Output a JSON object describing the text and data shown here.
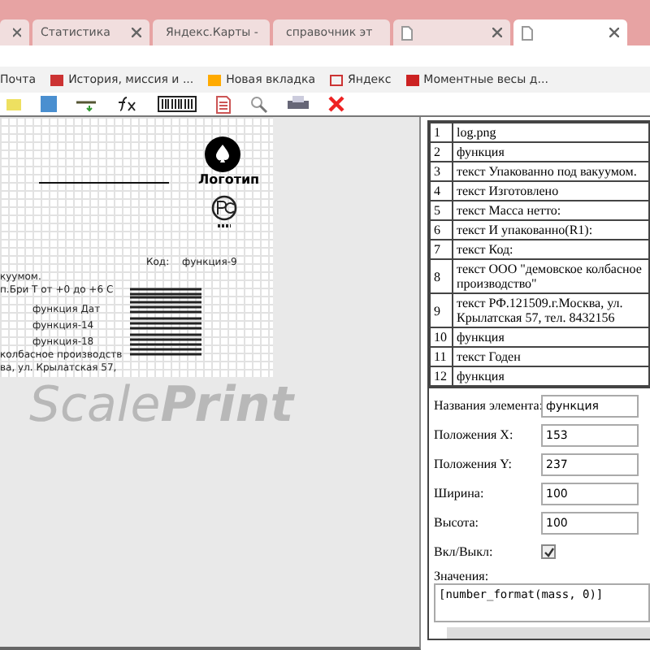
{
  "tabs": [
    {
      "selected": false
    },
    {
      "title": "Статистика",
      "selected": false,
      "kind": "plain"
    },
    {
      "title": "Яндекс.Карты -",
      "selected": false,
      "kind": "map"
    },
    {
      "title": "справочник эт",
      "selected": false,
      "kind": "doc"
    },
    {
      "selected": false,
      "kind": "doc"
    },
    {
      "selected": true,
      "kind": "doc"
    }
  ],
  "bookmarks": [
    {
      "title": "Почта",
      "kind": "plain"
    },
    {
      "title": "История, миссия и ...",
      "kind": "news"
    },
    {
      "title": "Новая вкладка",
      "kind": "flag"
    },
    {
      "title": "Яндекс",
      "kind": "yandex"
    },
    {
      "title": "Моментные весы д...",
      "kind": "scale"
    }
  ],
  "canvas": {
    "logo_label": "Логотип",
    "texts": [
      "Код:",
      "функция-9",
      "куумом.",
      "п.Бри T от +0 до +6 С",
      "функция Дат",
      "функция-14",
      "функция-18",
      "колбасное производств",
      "ва, ул. Крылатская 57,"
    ],
    "brand": "Scale**Print**"
  },
  "elements": [
    {
      "num": "1",
      "text": "log.png"
    },
    {
      "num": "2",
      "text": "функция"
    },
    {
      "num": "3",
      "text": "текст Упакованно под вакуумом."
    },
    {
      "num": "4",
      "text": "текст Изготовлено"
    },
    {
      "num": "5",
      "text": "текст Масса нетто:"
    },
    {
      "num": "6",
      "text": "текст И упакованно(R1):"
    },
    {
      "num": "7",
      "text": "текст Код:"
    },
    {
      "num": "8",
      "text": "текст ООО \"демовское колбасное производство\""
    },
    {
      "num": "9",
      "text": "текст РФ.121509.г.Москва, ул. Крылатская 57, тел. 8432156"
    },
    {
      "num": "10",
      "text": "функция"
    },
    {
      "num": "11",
      "text": "текст Годен"
    },
    {
      "num": "12",
      "text": "функция"
    }
  ],
  "properties": [
    {
      "kind": "text",
      "label": "Названия элемента:",
      "value": "функция"
    },
    {
      "kind": "text",
      "label": "Положения X:",
      "value": "153"
    },
    {
      "kind": "text",
      "label": "Положения Y:",
      "value": "237"
    },
    {
      "kind": "text",
      "label": "Ширина:",
      "value": "100"
    },
    {
      "kind": "text",
      "label": "Высота:",
      "value": "100"
    },
    {
      "kind": "checkbox",
      "label": "Вкл/Выкл:",
      "checked": true
    },
    {
      "kind": "textarea",
      "label": "Значения:",
      "value": "[number_format(mass, 0)]"
    }
  ]
}
